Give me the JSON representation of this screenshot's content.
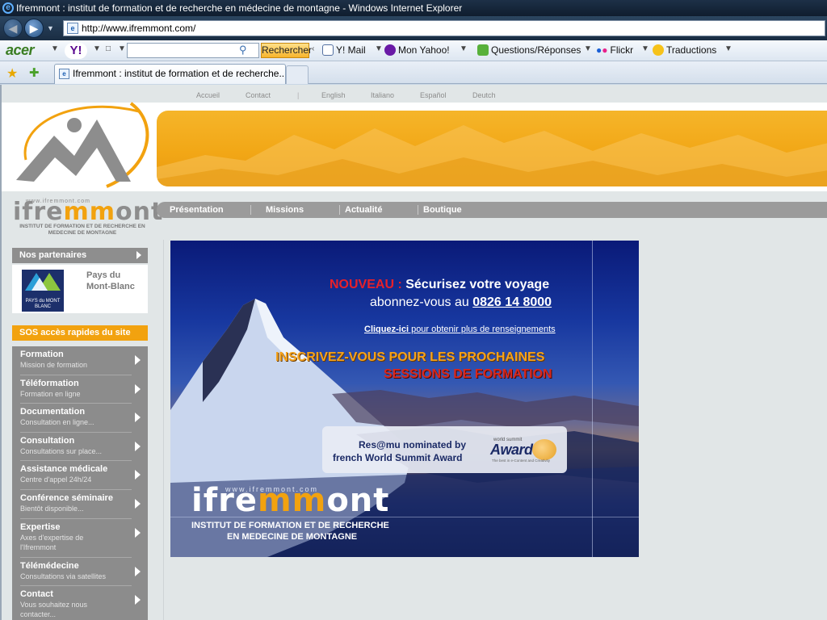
{
  "window": {
    "title": "Ifremmont : institut de formation et de recherche en médecine de montagne - Windows Internet Explorer",
    "url": "http://www.ifremmont.com/"
  },
  "toolbar": {
    "acer": "acer",
    "yahoo": "Y!",
    "search_button": "Rechercher",
    "items": [
      "Y! Mail",
      "Mon Yahoo!",
      "Questions/Réponses",
      "Flickr",
      "Traductions"
    ],
    "icons": [
      "mail-icon",
      "yahoo-icon",
      "answers-icon",
      "flickr-icon",
      "translate-icon"
    ]
  },
  "tabs": {
    "active": "Ifremmont : institut de formation et de recherche..."
  },
  "topnav": {
    "links": [
      "Accueil",
      "Contact",
      "English",
      "Italiano",
      "Español",
      "Deutch"
    ]
  },
  "brand": {
    "url": "www.ifremmont.com",
    "word_pre": "ifre",
    "word_mid": "mm",
    "word_post": "ont",
    "subtitle": "INSTITUT DE FORMATION ET DE RECHERCHE EN MEDECINE DE MONTAGNE"
  },
  "mainnav": {
    "items": [
      "Présentation",
      "Missions",
      "Actualité",
      "Boutique"
    ]
  },
  "sidebar": {
    "partners_title": "Nos partenaires",
    "partner_name": "Pays du Mont-Blanc",
    "partner_logo_text": "PAYS du MONT BLANC",
    "sos_title": "SOS accès rapides du site",
    "items": [
      {
        "title": "Formation",
        "sub": "Mission de formation"
      },
      {
        "title": "Téléformation",
        "sub": "Formation en ligne"
      },
      {
        "title": "Documentation",
        "sub": "Consultation en ligne..."
      },
      {
        "title": "Consultation",
        "sub": "Consultations sur place..."
      },
      {
        "title": "Assistance médicale",
        "sub": "Centre d'appel 24h/24"
      },
      {
        "title": "Conférence séminaire",
        "sub": "Bientôt disponible..."
      },
      {
        "title": "Expertise",
        "sub": "Axes d'expertise de l'Ifremmont"
      },
      {
        "title": "Télémédecine",
        "sub": "Consultations via satellites"
      },
      {
        "title": "Contact",
        "sub": "Vous souhaitez nous contacter..."
      }
    ]
  },
  "hero": {
    "nouveau": "NOUVEAU : ",
    "secure": "Sécurisez votre voyage",
    "abonnez": "abonnez-vous au ",
    "phone": "0826 14 8000",
    "cliquez_link": "Cliquez-ici",
    "cliquez_rest": " pour obtenir plus de renseignements",
    "inscrivez": "INSCRIVEZ-VOUS POUR LES PROCHAINES",
    "sessions": "SESSIONS DE FORMATION",
    "award_line1": "Res@mu nominated by",
    "award_line2": "french World Summit Award",
    "award_small": "world summit",
    "award_big": "Award",
    "award_tag": "The best in e-Content and Creativity",
    "url": "www.ifremmont.com",
    "brand_pre": "ifre",
    "brand_mid": "mm",
    "brand_post": "ont",
    "sub1": "INSTITUT DE FORMATION ET DE RECHERCHE",
    "sub2": "EN MEDECINE DE MONTAGNE"
  },
  "colors": {
    "accent_orange": "#f2a20f",
    "nav_grey": "#9b9b9b",
    "nouveau_red": "#e8202a"
  }
}
